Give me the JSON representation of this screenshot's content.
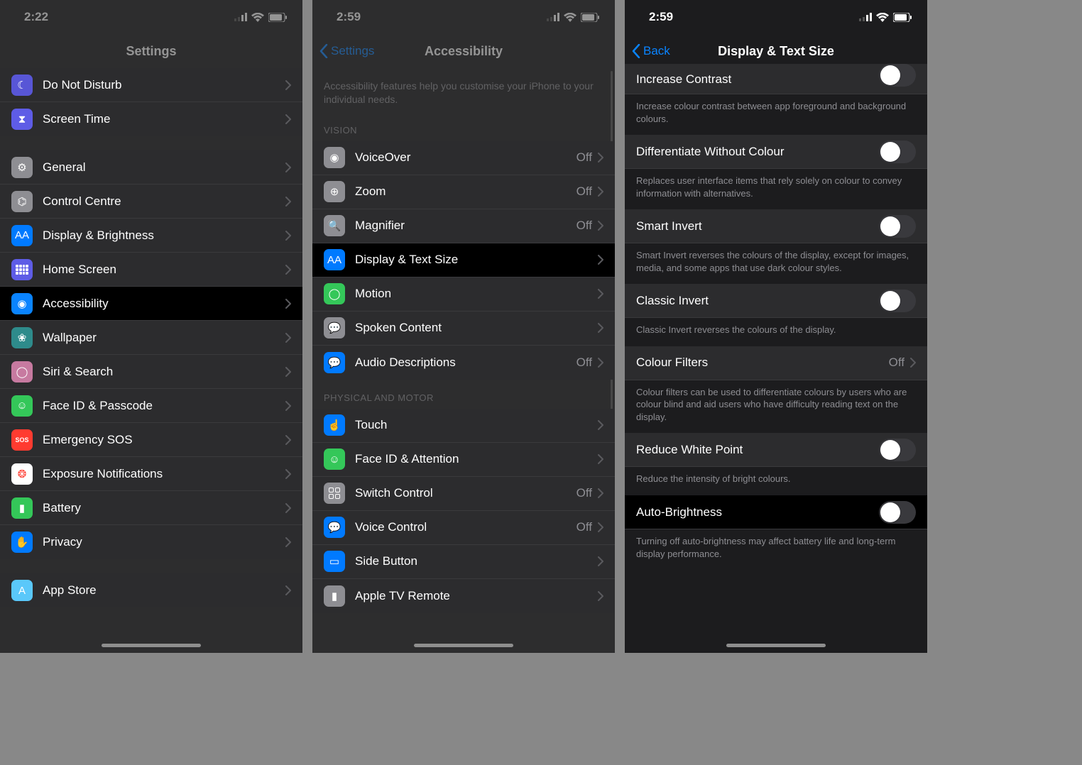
{
  "phones": {
    "p1": {
      "time": "2:22",
      "title": "Settings",
      "rows1": [
        {
          "icon": "moon-icon",
          "bg": "ic-purple",
          "glyph": "☾",
          "label": "Do Not Disturb"
        },
        {
          "icon": "hourglass-icon",
          "bg": "ic-indigo",
          "glyph": "⧗",
          "label": "Screen Time"
        }
      ],
      "rows2": [
        {
          "icon": "gear-icon",
          "bg": "ic-gray",
          "glyph": "⚙",
          "label": "General"
        },
        {
          "icon": "toggles-icon",
          "bg": "ic-gray",
          "glyph": "⌬",
          "label": "Control Centre"
        },
        {
          "icon": "text-size-icon",
          "bg": "ic-blue",
          "glyph": "AA",
          "label": "Display & Brightness"
        },
        {
          "icon": "home-screen-icon",
          "bg": "ic-indigo",
          "glyph": "dots",
          "label": "Home Screen"
        },
        {
          "icon": "accessibility-icon",
          "bg": "ic-dblue",
          "glyph": "◉",
          "label": "Accessibility",
          "highlight": true
        },
        {
          "icon": "wallpaper-icon",
          "bg": "ic-teal",
          "glyph": "❀",
          "label": "Wallpaper"
        },
        {
          "icon": "siri-icon",
          "bg": "ic-pink",
          "glyph": "◯",
          "label": "Siri & Search"
        },
        {
          "icon": "faceid-icon",
          "bg": "ic-green",
          "glyph": "☺",
          "label": "Face ID & Passcode"
        },
        {
          "icon": "sos-icon",
          "bg": "ic-red",
          "glyph": "SOS",
          "label": "Emergency SOS"
        },
        {
          "icon": "exposure-icon",
          "bg": "ic-white",
          "glyph": "❂",
          "label": "Exposure Notifications"
        },
        {
          "icon": "battery-icon",
          "bg": "ic-green",
          "glyph": "▮",
          "label": "Battery"
        },
        {
          "icon": "privacy-icon",
          "bg": "ic-blue",
          "glyph": "✋",
          "label": "Privacy"
        }
      ],
      "rows3": [
        {
          "icon": "appstore-icon",
          "bg": "ic-lblue",
          "glyph": "A",
          "label": "App Store"
        }
      ]
    },
    "p2": {
      "time": "2:59",
      "back": "Settings",
      "title": "Accessibility",
      "intro": "Accessibility features help you customise your iPhone to your individual needs.",
      "sectionVision": "VISION",
      "visionRows": [
        {
          "icon": "voiceover-icon",
          "bg": "ic-gray",
          "glyph": "◉",
          "label": "VoiceOver",
          "value": "Off"
        },
        {
          "icon": "zoom-icon",
          "bg": "ic-gray",
          "glyph": "⊕",
          "label": "Zoom",
          "value": "Off"
        },
        {
          "icon": "magnifier-icon",
          "bg": "ic-gray",
          "glyph": "🔍",
          "label": "Magnifier",
          "value": "Off"
        },
        {
          "icon": "display-text-icon",
          "bg": "ic-blue",
          "glyph": "AA",
          "label": "Display & Text Size",
          "highlight": true
        },
        {
          "icon": "motion-icon",
          "bg": "ic-green",
          "glyph": "◯",
          "label": "Motion"
        },
        {
          "icon": "spoken-content-icon",
          "bg": "ic-gray",
          "glyph": "💬",
          "label": "Spoken Content"
        },
        {
          "icon": "audio-desc-icon",
          "bg": "ic-blue",
          "glyph": "💬",
          "label": "Audio Descriptions",
          "value": "Off"
        }
      ],
      "sectionPhysical": "PHYSICAL AND MOTOR",
      "physicalRows": [
        {
          "icon": "touch-icon",
          "bg": "ic-blue",
          "glyph": "☝",
          "label": "Touch"
        },
        {
          "icon": "faceid-attn-icon",
          "bg": "ic-green",
          "glyph": "☺",
          "label": "Face ID & Attention"
        },
        {
          "icon": "switch-control-icon",
          "bg": "ic-gray",
          "glyph": "grid",
          "label": "Switch Control",
          "value": "Off"
        },
        {
          "icon": "voice-control-icon",
          "bg": "ic-blue",
          "glyph": "💬",
          "label": "Voice Control",
          "value": "Off"
        },
        {
          "icon": "side-button-icon",
          "bg": "ic-blue",
          "glyph": "▭",
          "label": "Side Button"
        },
        {
          "icon": "apple-tv-icon",
          "bg": "ic-gray",
          "glyph": "▮",
          "label": "Apple TV Remote"
        }
      ]
    },
    "p3": {
      "time": "2:59",
      "back": "Back",
      "title": "Display & Text Size",
      "rowContrast": {
        "label": "Increase Contrast",
        "footer": "Increase colour contrast between app foreground and background colours."
      },
      "rowDiff": {
        "label": "Differentiate Without Colour",
        "footer": "Replaces user interface items that rely solely on colour to convey information with alternatives."
      },
      "rowSmart": {
        "label": "Smart Invert",
        "footer": "Smart Invert reverses the colours of the display, except for images, media, and some apps that use dark colour styles."
      },
      "rowClassic": {
        "label": "Classic Invert",
        "footer": "Classic Invert reverses the colours of the display."
      },
      "rowFilters": {
        "label": "Colour Filters",
        "value": "Off",
        "footer": "Colour filters can be used to differentiate colours by users who are colour blind and aid users who have difficulty reading text on the display."
      },
      "rowWhite": {
        "label": "Reduce White Point",
        "footer": "Reduce the intensity of bright colours."
      },
      "rowAuto": {
        "label": "Auto-Brightness",
        "footer": "Turning off auto-brightness may affect battery life and long-term display performance."
      }
    }
  }
}
